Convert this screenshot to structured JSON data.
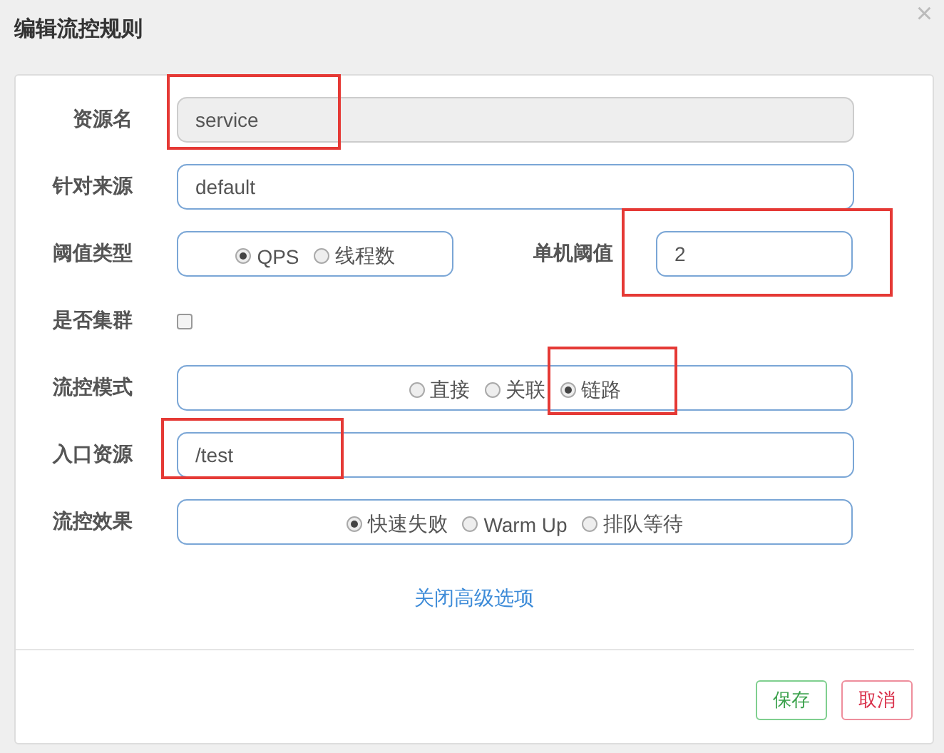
{
  "dialog": {
    "title": "编辑流控规则",
    "close": "×"
  },
  "fields": [
    {
      "kind": "input",
      "label": "资源名",
      "value": "service",
      "disabled": true,
      "highlighted": true
    },
    {
      "kind": "input",
      "label": "针对来源",
      "value": "default",
      "disabled": false,
      "highlighted": false
    },
    {
      "kind": "radios",
      "label": "阈值类型",
      "options": [
        {
          "label": "QPS",
          "selected": true,
          "highlighted": false
        },
        {
          "label": "线程数",
          "selected": false,
          "highlighted": false
        }
      ],
      "side": {
        "label": "单机阈值",
        "value": "2",
        "highlighted": true
      }
    },
    {
      "kind": "checkbox",
      "label": "是否集群",
      "checked": false
    },
    {
      "kind": "radios",
      "label": "流控模式",
      "options": [
        {
          "label": "直接",
          "selected": false,
          "highlighted": false
        },
        {
          "label": "关联",
          "selected": false,
          "highlighted": false
        },
        {
          "label": "链路",
          "selected": true,
          "highlighted": true
        }
      ]
    },
    {
      "kind": "input",
      "label": "入口资源",
      "value": "/test",
      "disabled": false,
      "highlighted": true
    },
    {
      "kind": "radios",
      "label": "流控效果",
      "options": [
        {
          "label": "快速失败",
          "selected": true,
          "highlighted": false
        },
        {
          "label": "Warm Up",
          "selected": false,
          "highlighted": false
        },
        {
          "label": "排队等待",
          "selected": false,
          "highlighted": false
        }
      ]
    }
  ],
  "advanced_link": "关闭高级选项",
  "buttons": [
    {
      "label": "保存",
      "kind": "save"
    },
    {
      "label": "取消",
      "kind": "cancel"
    }
  ]
}
